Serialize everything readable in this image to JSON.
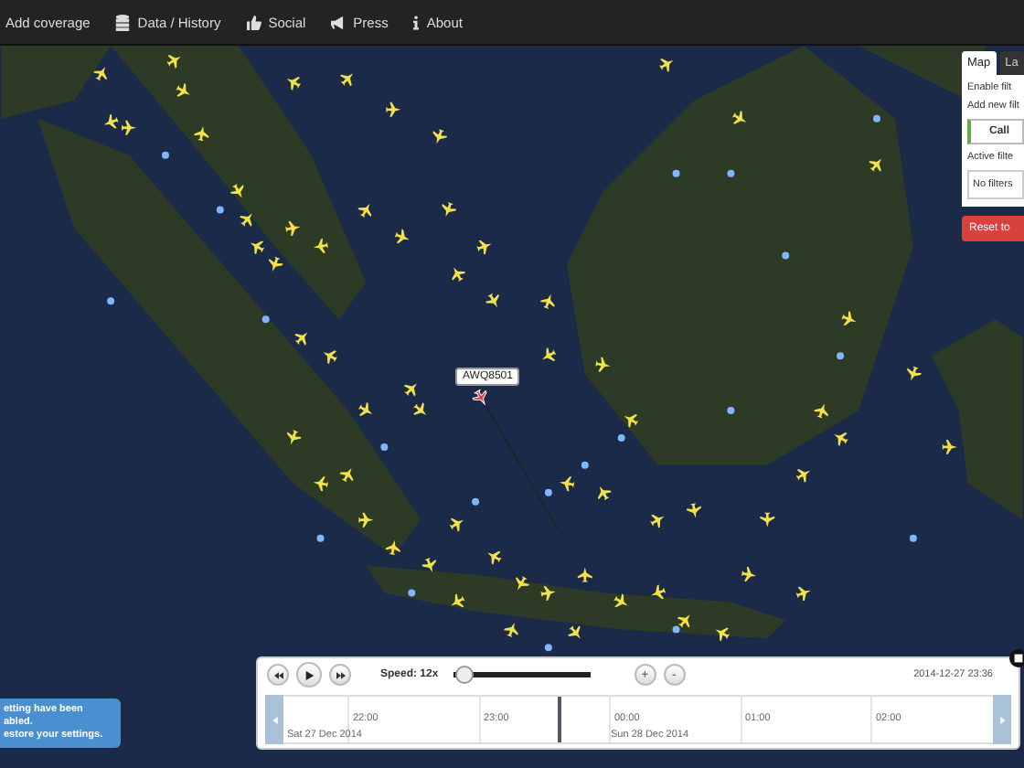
{
  "nav": {
    "items": [
      {
        "label": "Add coverage",
        "kind": "plain"
      },
      {
        "label": "Data / History",
        "kind": "database"
      },
      {
        "label": "Social",
        "kind": "thumb"
      },
      {
        "label": "Press",
        "kind": "megaphone"
      },
      {
        "label": "About",
        "kind": "info"
      }
    ]
  },
  "map": {
    "selected_flight": {
      "callsign": "AWQ8501"
    }
  },
  "side_panel": {
    "tabs": [
      {
        "label": "Map",
        "selected": true
      },
      {
        "label": "La",
        "selected": false
      }
    ],
    "enable_filters_label": "Enable filt",
    "add_filter_label": "Add new filt",
    "filter_type_button": "Call",
    "active_filters_label": "Active filte",
    "active_filters_value": "No filters",
    "reset_button": "Reset to"
  },
  "notification": {
    "text": "etting have been\nabled.\nestore your settings."
  },
  "playback": {
    "speed_label": "Speed: 12x",
    "speed_slider": {
      "level": 0.02
    },
    "zoom_in": "+",
    "zoom_out": "-",
    "datetime": "2014-12-27 23:36",
    "hours": [
      "22:00",
      "23:00",
      "00:00",
      "01:00",
      "02:00"
    ],
    "dates": [
      "Sat 27 Dec 2014",
      "Sun 28 Dec 2014"
    ]
  }
}
